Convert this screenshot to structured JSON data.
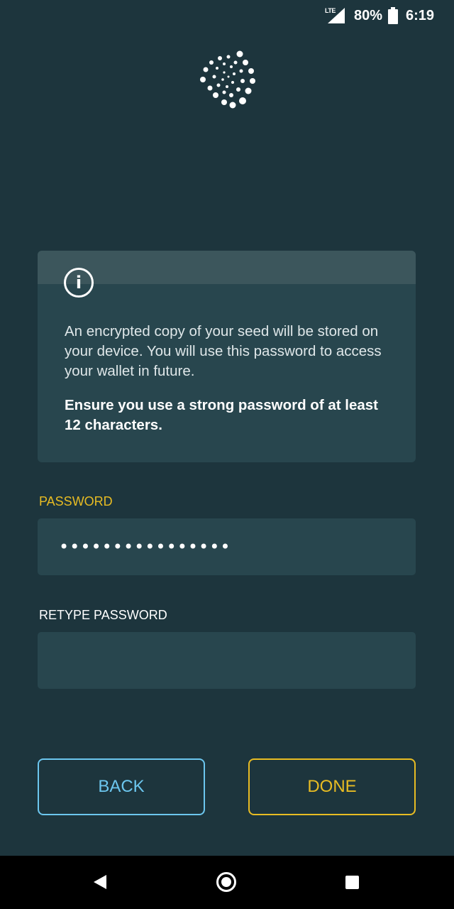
{
  "status_bar": {
    "network": "LTE",
    "battery_percent": "80%",
    "time": "6:19",
    "icons": [
      "signal-icon",
      "battery-icon"
    ]
  },
  "logo": {
    "icon": "iota-logo-icon"
  },
  "info": {
    "icon": "info-icon",
    "icon_glyph": "i",
    "message": "An encrypted copy of your seed will be stored on your device. You will use this password to access your wallet in future.",
    "emphasis": "Ensure you use a strong password of at least 12 characters."
  },
  "form": {
    "password_label": "PASSWORD",
    "password_value": "••••••••••••••••",
    "retype_label": "RETYPE PASSWORD",
    "retype_value": ""
  },
  "buttons": {
    "back_label": "BACK",
    "done_label": "DONE"
  },
  "colors": {
    "background": "#1d353d",
    "card": "#28464e",
    "accent_yellow": "#e8bc23",
    "accent_blue": "#6cc6ee"
  },
  "nav_bar": {
    "icons": [
      "nav-back-icon",
      "nav-home-icon",
      "nav-recents-icon"
    ]
  }
}
